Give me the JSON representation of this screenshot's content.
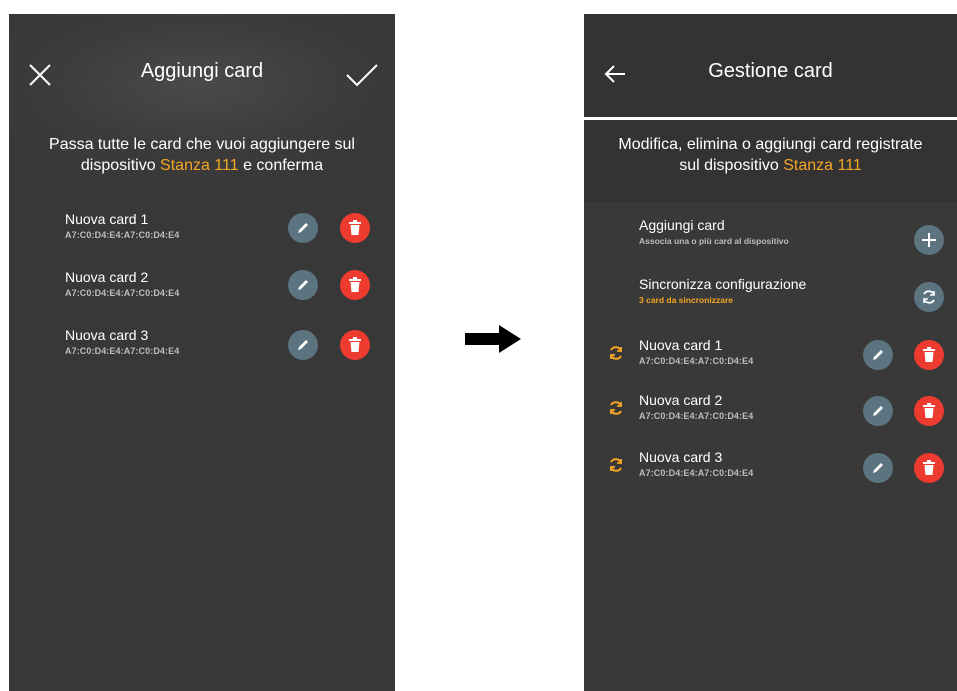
{
  "left_screen": {
    "title": "Aggiungi card",
    "close_icon": "close-icon",
    "confirm_icon": "check-icon",
    "intro_line1": "Passa tutte le card che vuoi aggiungere sul",
    "intro_line2_prefix": "dispositivo ",
    "intro_device": "Stanza 111",
    "intro_line2_suffix": " e conferma",
    "cards": [
      {
        "name": "Nuova card 1",
        "mac": "A7:C0:D4:E4:A7:C0:D4:E4"
      },
      {
        "name": "Nuova card 2",
        "mac": "A7:C0:D4:E4:A7:C0:D4:E4"
      },
      {
        "name": "Nuova card 3",
        "mac": "A7:C0:D4:E4:A7:C0:D4:E4"
      }
    ]
  },
  "transition_icon": "right-arrow-icon",
  "right_screen": {
    "title": "Gestione card",
    "back_icon": "back-arrow-icon",
    "intro_line1": "Modifica, elimina o aggiungi card registrate",
    "intro_line2_prefix": "sul dispositivo ",
    "intro_device": "Stanza 111",
    "add_card": {
      "label": "Aggiungi card",
      "sub": "Associa una o più card al dispositivo"
    },
    "sync": {
      "label": "Sincronizza configurazione",
      "sub": "3 card da sincronizzare"
    },
    "cards": [
      {
        "name": "Nuova card 1",
        "mac": "A7:C0:D4:E4:A7:C0:D4:E4"
      },
      {
        "name": "Nuova card 2",
        "mac": "A7:C0:D4:E4:A7:C0:D4:E4"
      },
      {
        "name": "Nuova card 3",
        "mac": "A7:C0:D4:E4:A7:C0:D4:E4"
      }
    ]
  },
  "colors": {
    "accent": "#f5a623",
    "edit": "#5b7480",
    "delete": "#ee3b2f",
    "background": "#3a3a3a"
  }
}
